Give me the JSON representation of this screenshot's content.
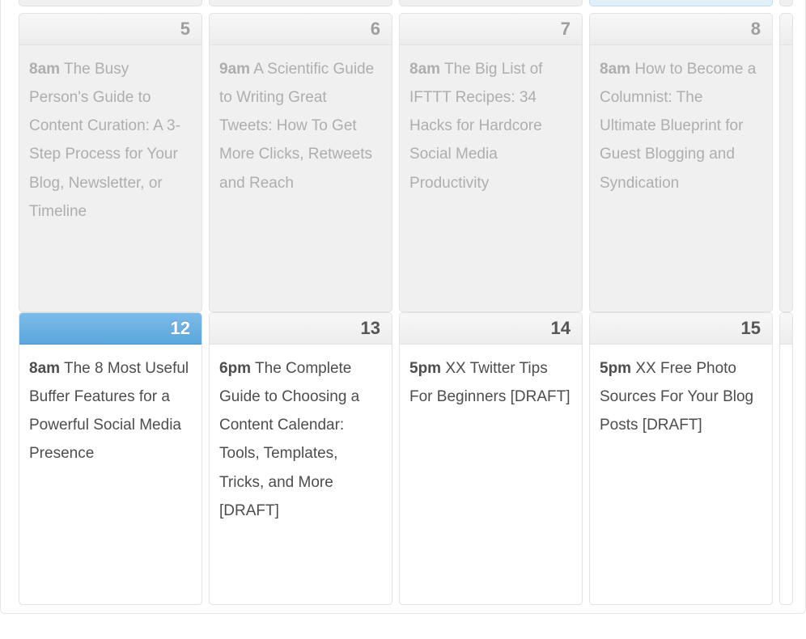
{
  "calendar": {
    "top_slivers": [
      {
        "highlight": false
      },
      {
        "highlight": false
      },
      {
        "highlight": false
      },
      {
        "highlight": true
      },
      {
        "highlight": false,
        "frag": true
      }
    ],
    "week1": [
      {
        "day": "5",
        "state": "past",
        "events": [
          {
            "time": "8am",
            "title": "The Busy Person's Guide to Content Curation: A 3-Step Process for Your Blog, Newsletter, or Timeline"
          }
        ]
      },
      {
        "day": "6",
        "state": "past",
        "events": [
          {
            "time": "9am",
            "title": "A Scientific Guide to Writing Great Tweets: How To Get More Clicks, Retweets and Reach"
          }
        ]
      },
      {
        "day": "7",
        "state": "past",
        "events": [
          {
            "time": "8am",
            "title": "The Big List of IFTTT Recipes: 34 Hacks for Hardcore Social Media Productivity"
          }
        ]
      },
      {
        "day": "8",
        "state": "past",
        "events": [
          {
            "time": "8am",
            "title": "How to Become a Columnist: The Ultimate Blueprint for Guest Blogging and Syndication"
          }
        ]
      },
      {
        "day": "",
        "state": "past",
        "frag": true
      }
    ],
    "week2": [
      {
        "day": "12",
        "state": "today",
        "events": [
          {
            "time": "8am",
            "title": "The 8 Most Useful Buffer Features for a Powerful Social Media Presence"
          }
        ]
      },
      {
        "day": "13",
        "state": "upcoming",
        "events": [
          {
            "time": "6pm",
            "title": "The Complete Guide to Choosing a Content Calendar: Tools, Templates, Tricks, and More [DRAFT]"
          }
        ]
      },
      {
        "day": "14",
        "state": "upcoming",
        "events": [
          {
            "time": "5pm",
            "title": "XX Twitter Tips For Beginners [DRAFT]"
          }
        ]
      },
      {
        "day": "15",
        "state": "upcoming",
        "events": [
          {
            "time": "5pm",
            "title": "XX Free Photo Sources For Your Blog Posts [DRAFT]"
          }
        ]
      },
      {
        "day": "",
        "state": "upcoming",
        "frag": true
      }
    ]
  }
}
